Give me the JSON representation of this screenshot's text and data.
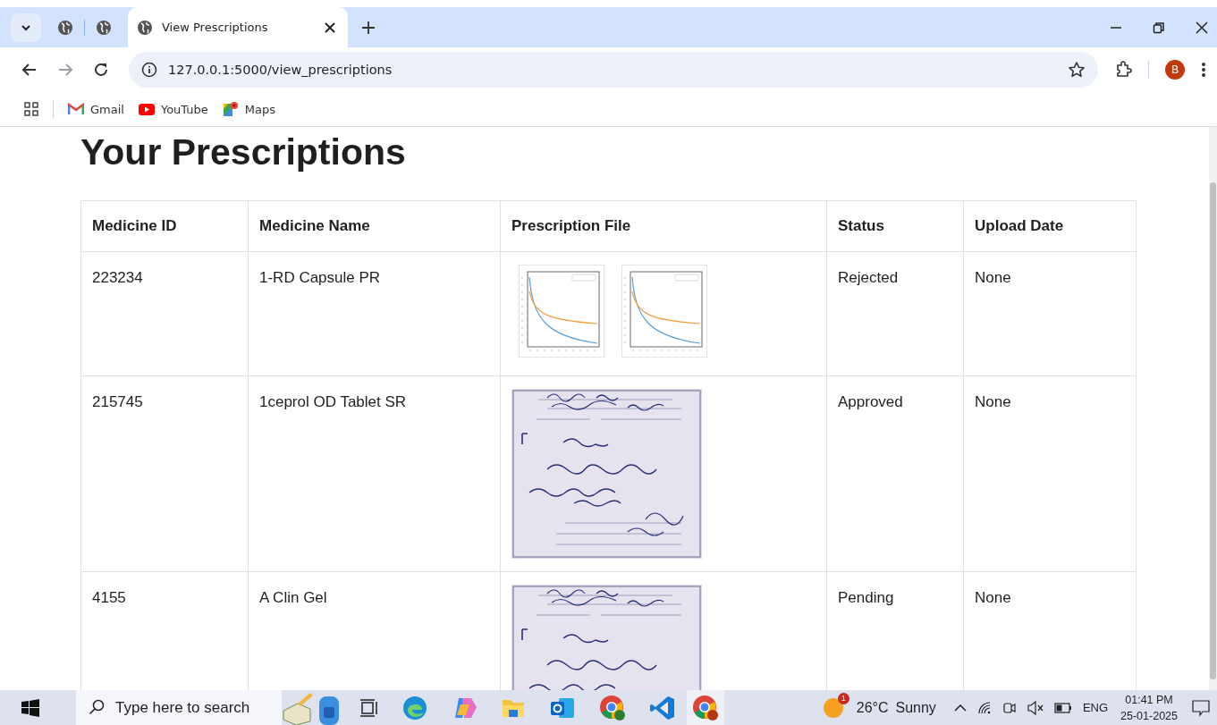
{
  "browser": {
    "tabs": [
      {
        "selected": false
      },
      {
        "selected": false
      },
      {
        "label": "View Prescriptions",
        "selected": true
      }
    ],
    "nav": [
      {
        "kind": "back",
        "disabled": false
      },
      {
        "kind": "forward",
        "disabled": true
      },
      {
        "kind": "reload",
        "disabled": false
      }
    ],
    "address": "127.0.0.1:5000/view_prescriptions",
    "profile": "B",
    "bookmarks": [
      {
        "kind": "gmail",
        "label": "Gmail"
      },
      {
        "kind": "youtube",
        "label": "YouTube"
      },
      {
        "kind": "maps",
        "label": "Maps"
      }
    ]
  },
  "page": {
    "title": "Your Prescriptions",
    "table": {
      "columns": [
        "Medicine ID",
        "Medicine Name",
        "Prescription File",
        "Status",
        "Upload Date"
      ],
      "rows": [
        {
          "id": "223234",
          "name": "1-RD Capsule PR",
          "status": "Rejected",
          "upload_date": "None"
        },
        {
          "id": "215745",
          "name": "1ceprol OD Tablet SR",
          "status": "Approved",
          "upload_date": "None"
        },
        {
          "id": "4155",
          "name": "A Clin Gel",
          "status": "Pending",
          "upload_date": "None"
        }
      ]
    }
  },
  "taskbar": {
    "search": {
      "placeholder": "Type here to search"
    },
    "weather": {
      "badge": "1",
      "temperature": "26°C",
      "condition": "Sunny"
    },
    "language": "ENG",
    "time": "01:41 PM",
    "date": "25-01-2025"
  }
}
